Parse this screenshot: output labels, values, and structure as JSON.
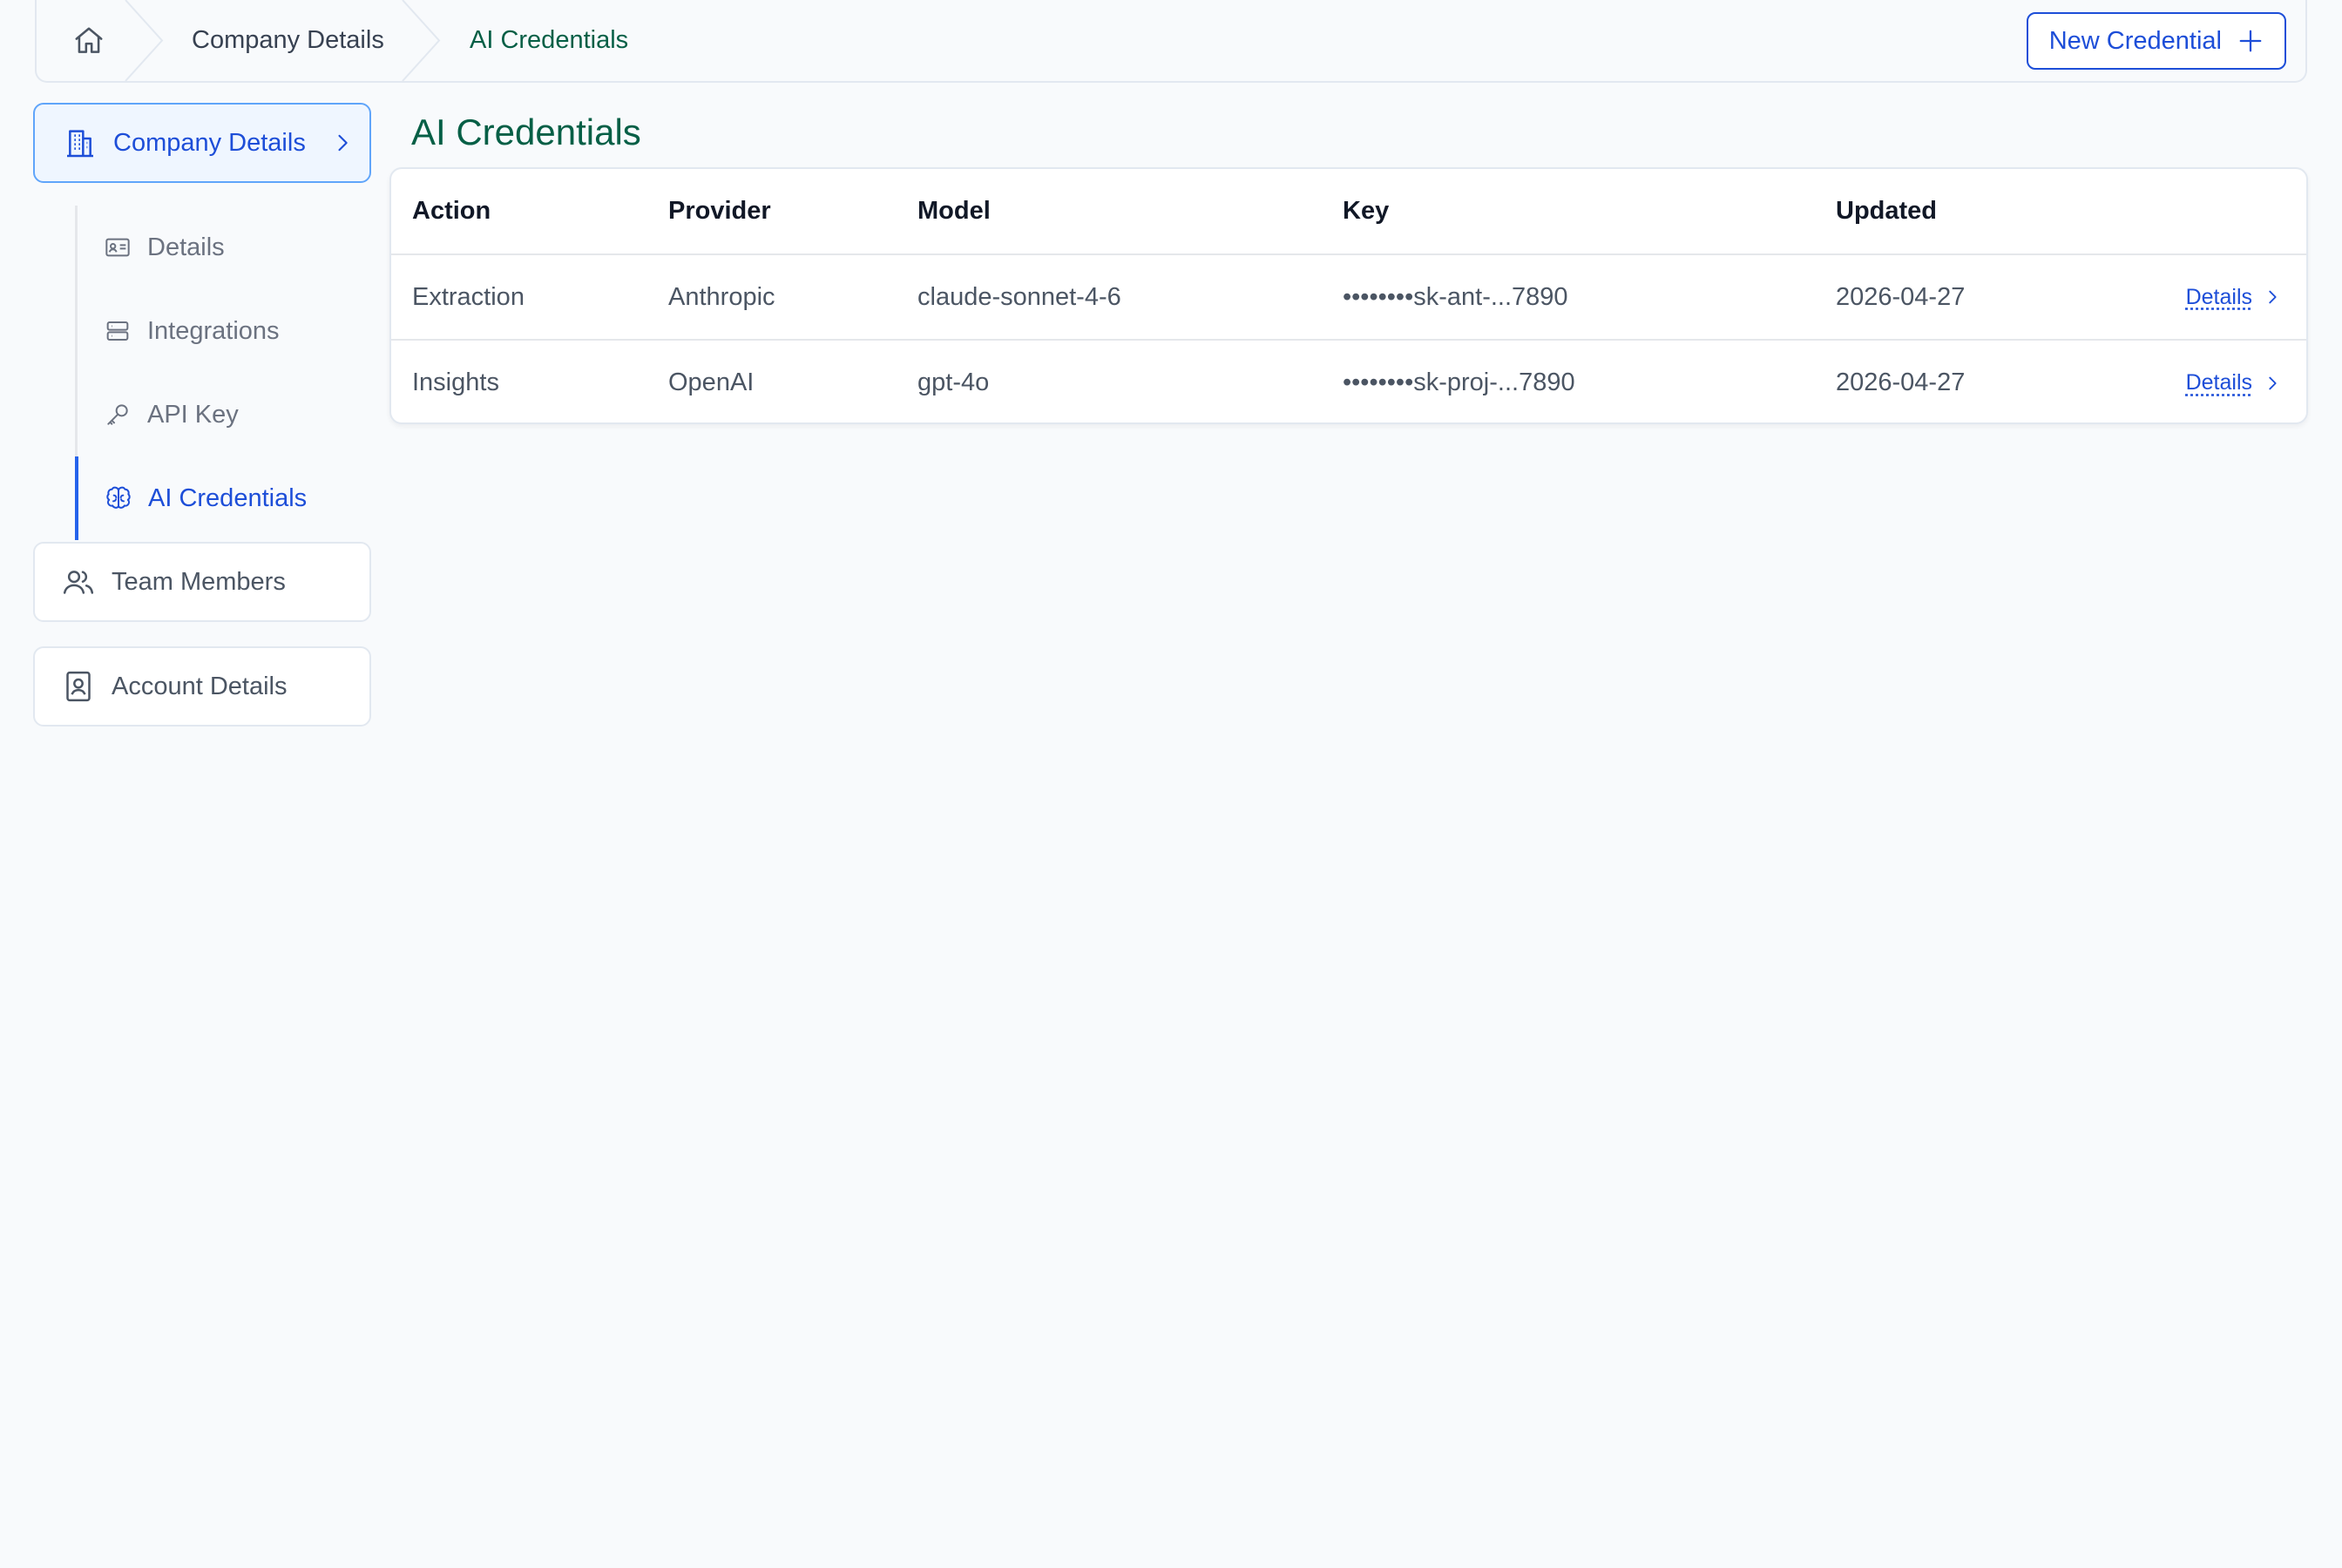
{
  "breadcrumb": {
    "home_icon": "home-icon",
    "items": [
      {
        "label": "Company Details"
      },
      {
        "label": "AI Credentials"
      }
    ]
  },
  "header": {
    "new_button_label": "New Credential"
  },
  "sidebar": {
    "sections": [
      {
        "label": "Company Details",
        "icon": "building-icon",
        "active": true
      },
      {
        "label": "Team Members",
        "icon": "users-icon",
        "active": false
      },
      {
        "label": "Account Details",
        "icon": "contact-card-icon",
        "active": false
      }
    ],
    "sub_items": [
      {
        "label": "Details",
        "icon": "id-card-icon",
        "active": false
      },
      {
        "label": "Integrations",
        "icon": "server-icon",
        "active": false
      },
      {
        "label": "API Key",
        "icon": "key-icon",
        "active": false
      },
      {
        "label": "AI Credentials",
        "icon": "brain-icon",
        "active": true
      }
    ]
  },
  "main": {
    "title": "AI Credentials",
    "table": {
      "columns": [
        "Action",
        "Provider",
        "Model",
        "Key",
        "Updated"
      ],
      "rows": [
        {
          "action": "Extraction",
          "provider": "Anthropic",
          "model": "claude-sonnet-4-6",
          "key": "••••••••sk-ant-...7890",
          "updated": "2026-04-27",
          "link": "Details"
        },
        {
          "action": "Insights",
          "provider": "OpenAI",
          "model": "gpt-4o",
          "key": "••••••••sk-proj-...7890",
          "updated": "2026-04-27",
          "link": "Details"
        }
      ]
    }
  },
  "colors": {
    "accent": "#1d4ed8",
    "title_green": "#065f46",
    "background": "#f8fafc",
    "border": "#e2e8f0"
  }
}
